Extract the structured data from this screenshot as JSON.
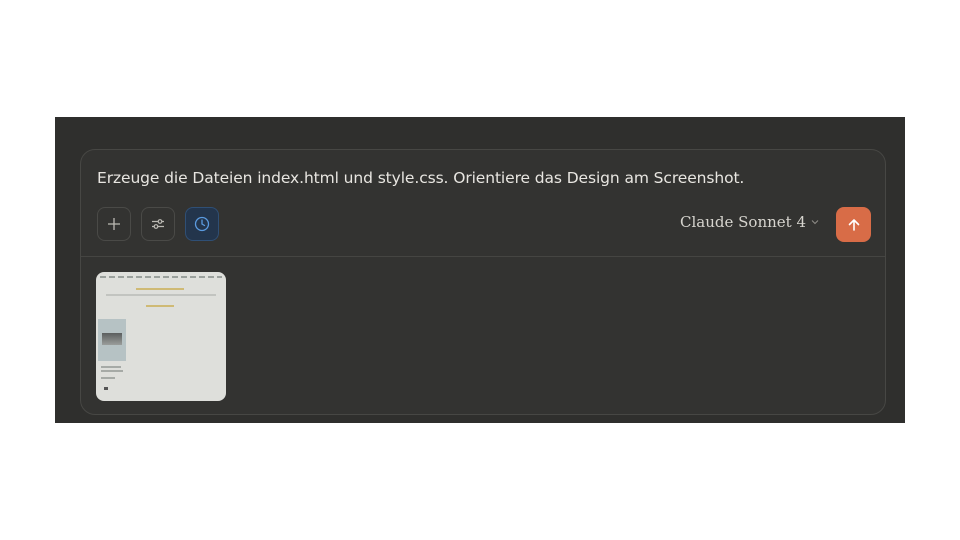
{
  "composer": {
    "prompt_text": "Erzeuge die Dateien index.html und style.css. Orientiere das Design am Screenshot.",
    "model_label": "Claude Sonnet 4"
  },
  "icons": {
    "add": "plus-icon",
    "settings": "sliders-icon",
    "history": "clock-icon",
    "model_dropdown": "chevron-down-icon",
    "send": "arrow-up-icon"
  },
  "colors": {
    "panel_bg": "#2f2f2d",
    "composer_bg": "#333331",
    "text": "#e8e6e1",
    "accent_send": "#d86c47",
    "active_tool": "#23354c"
  },
  "attachment": {
    "type": "screenshot-thumbnail"
  }
}
